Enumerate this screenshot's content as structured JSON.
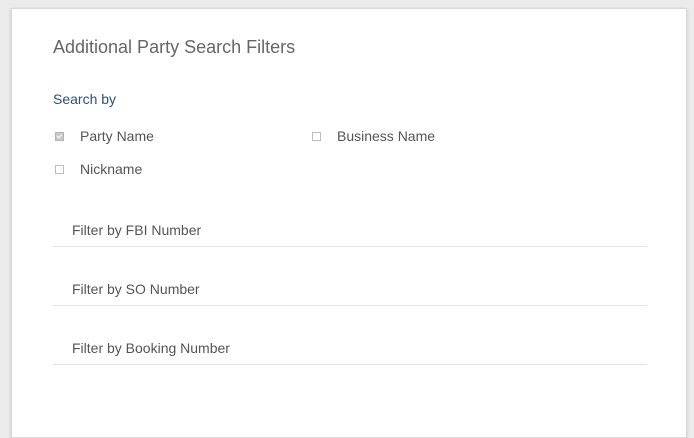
{
  "panel": {
    "title": "Additional Party Search Filters",
    "search_by_label": "Search by"
  },
  "search_by_options": [
    {
      "label": "Party Name",
      "checked": true
    },
    {
      "label": "Business Name",
      "checked": false
    },
    {
      "label": "Nickname",
      "checked": false
    }
  ],
  "filters": {
    "fbi_number_placeholder": "Filter by FBI Number",
    "so_number_placeholder": "Filter by SO Number",
    "booking_number_placeholder": "Filter by Booking Number"
  },
  "colors": {
    "accent": "#2c4f7c",
    "text": "#555555",
    "title": "#666666"
  }
}
